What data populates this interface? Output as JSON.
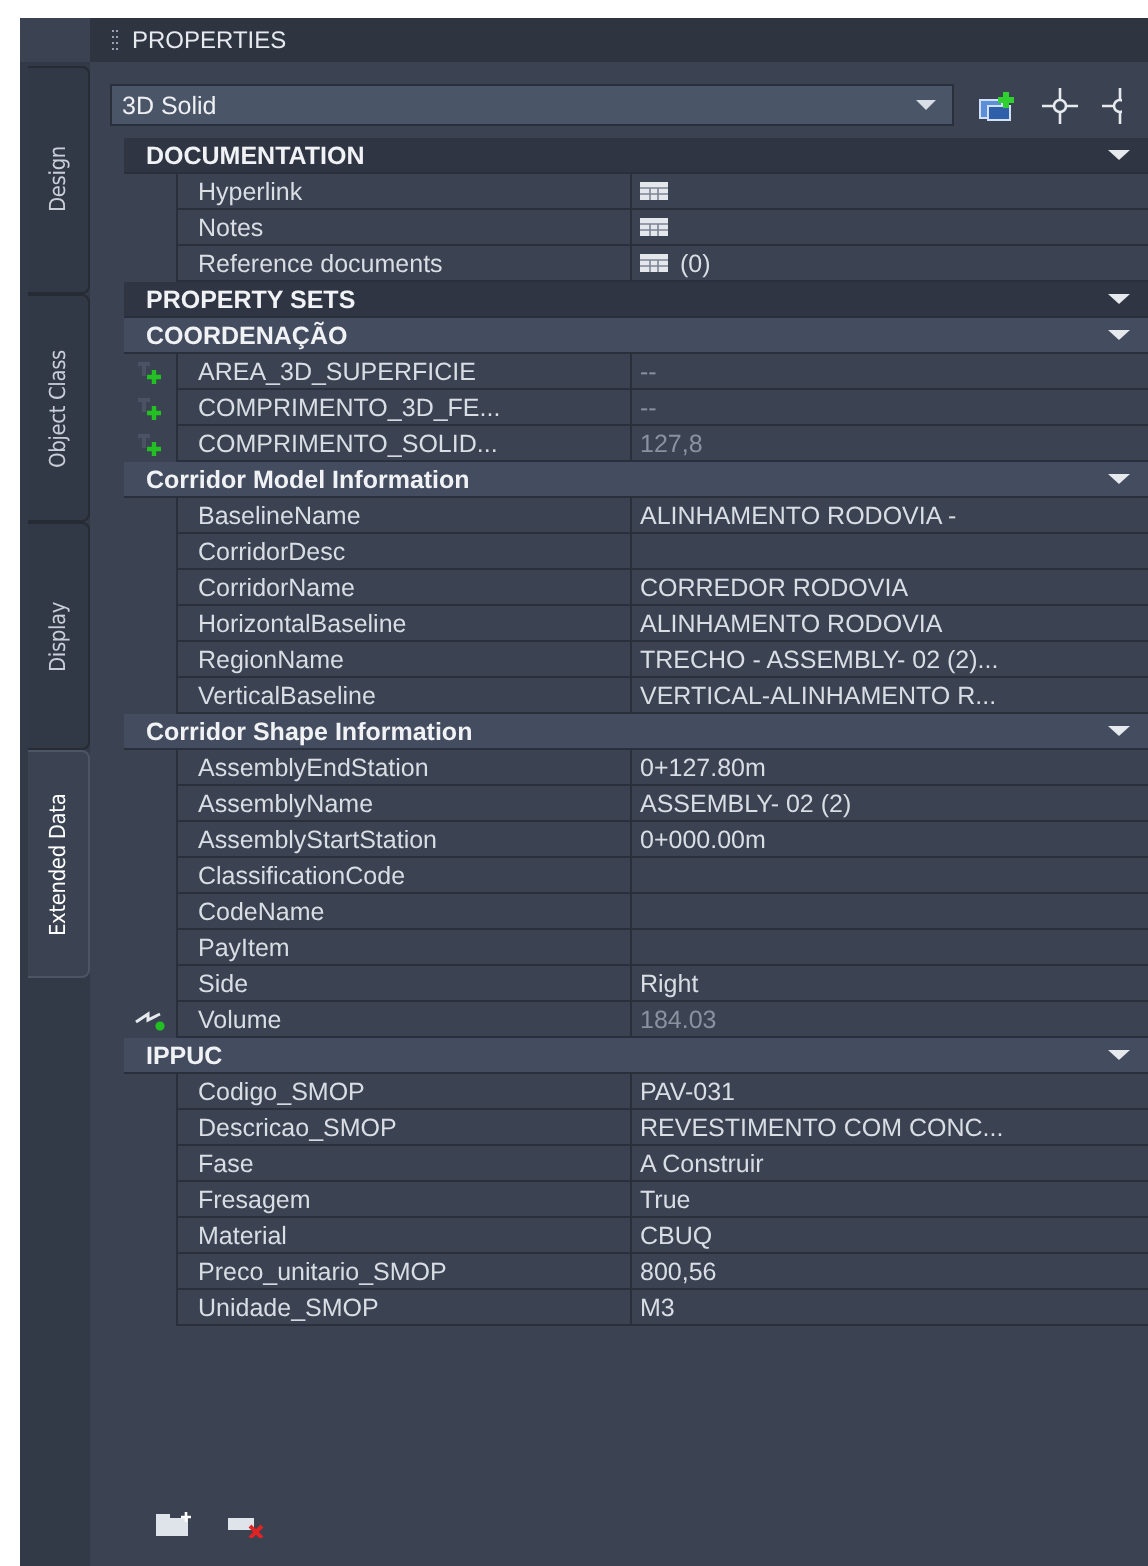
{
  "panel": {
    "title": "PROPERTIES"
  },
  "tabs": [
    {
      "label": "Design",
      "selected": false
    },
    {
      "label": "Object Class",
      "selected": false
    },
    {
      "label": "Display",
      "selected": false
    },
    {
      "label": "Extended Data",
      "selected": true
    }
  ],
  "selector": {
    "value": "3D Solid"
  },
  "sections": [
    {
      "title": "DOCUMENTATION",
      "kind": "category",
      "expanded": true,
      "rows": [
        {
          "label": "Hyperlink",
          "kind": "document",
          "disabled": false
        },
        {
          "label": "Notes",
          "kind": "document",
          "disabled": false
        },
        {
          "label": "Reference documents",
          "kind": "document",
          "value": "(0)",
          "disabled": false
        }
      ]
    },
    {
      "title": "PROPERTY SETS",
      "kind": "category",
      "expanded": true
    },
    {
      "title": "COORDENAÇÃO",
      "kind": "group",
      "expanded": true,
      "rows": [
        {
          "label": "AREA_3D_SUPERFICIE",
          "kind": "formula",
          "value": "--",
          "disabled": true
        },
        {
          "label": "COMPRIMENTO_3D_FE...",
          "kind": "formula",
          "value": "--",
          "disabled": true
        },
        {
          "label": "COMPRIMENTO_SOLID...",
          "kind": "formula",
          "value": "127,8",
          "disabled": true
        }
      ]
    },
    {
      "title": "Corridor Model Information",
      "kind": "group",
      "expanded": true,
      "rows": [
        {
          "label": "BaselineName",
          "kind": "plain",
          "value": "ALINHAMENTO RODOVIA -",
          "disabled": false
        },
        {
          "label": "CorridorDesc",
          "kind": "plain",
          "disabled": false
        },
        {
          "label": "CorridorName",
          "kind": "plain",
          "value": "CORREDOR RODOVIA",
          "disabled": false
        },
        {
          "label": "HorizontalBaseline",
          "kind": "plain",
          "value": "ALINHAMENTO RODOVIA",
          "disabled": false
        },
        {
          "label": "RegionName",
          "kind": "plain",
          "value": "TRECHO - ASSEMBLY- 02 (2)...",
          "disabled": false
        },
        {
          "label": "VerticalBaseline",
          "kind": "plain",
          "value": "VERTICAL-ALINHAMENTO R...",
          "disabled": false
        }
      ]
    },
    {
      "title": "Corridor Shape Information",
      "kind": "group",
      "expanded": true,
      "rows": [
        {
          "label": "AssemblyEndStation",
          "kind": "plain",
          "value": "0+127.80m",
          "disabled": false
        },
        {
          "label": "AssemblyName",
          "kind": "plain",
          "value": "ASSEMBLY- 02 (2)",
          "disabled": false
        },
        {
          "label": "AssemblyStartStation",
          "kind": "plain",
          "value": "0+000.00m",
          "disabled": false
        },
        {
          "label": "ClassificationCode",
          "kind": "plain",
          "disabled": false
        },
        {
          "label": "CodeName",
          "kind": "plain",
          "disabled": false
        },
        {
          "label": "PayItem",
          "kind": "plain",
          "disabled": false
        },
        {
          "label": "Side",
          "kind": "plain",
          "value": "Right",
          "disabled": false
        },
        {
          "label": "Volume",
          "kind": "calculated",
          "value": "184.03",
          "disabled": true
        }
      ]
    },
    {
      "title": "IPPUC",
      "kind": "group",
      "expanded": true,
      "rows": [
        {
          "label": "Codigo_SMOP",
          "kind": "plain",
          "value": "PAV-031",
          "disabled": false
        },
        {
          "label": "Descricao_SMOP",
          "kind": "plain",
          "value": "REVESTIMENTO COM CONC...",
          "disabled": false
        },
        {
          "label": "Fase",
          "kind": "plain",
          "value": "A Construir",
          "disabled": false
        },
        {
          "label": "Fresagem",
          "kind": "plain",
          "value": "True",
          "disabled": false
        },
        {
          "label": "Material",
          "kind": "plain",
          "value": "CBUQ",
          "disabled": false
        },
        {
          "label": "Preco_unitario_SMOP",
          "kind": "plain",
          "value": "800,56",
          "disabled": false
        },
        {
          "label": "Unidade_SMOP",
          "kind": "plain",
          "value": "M3",
          "disabled": false
        }
      ]
    }
  ]
}
